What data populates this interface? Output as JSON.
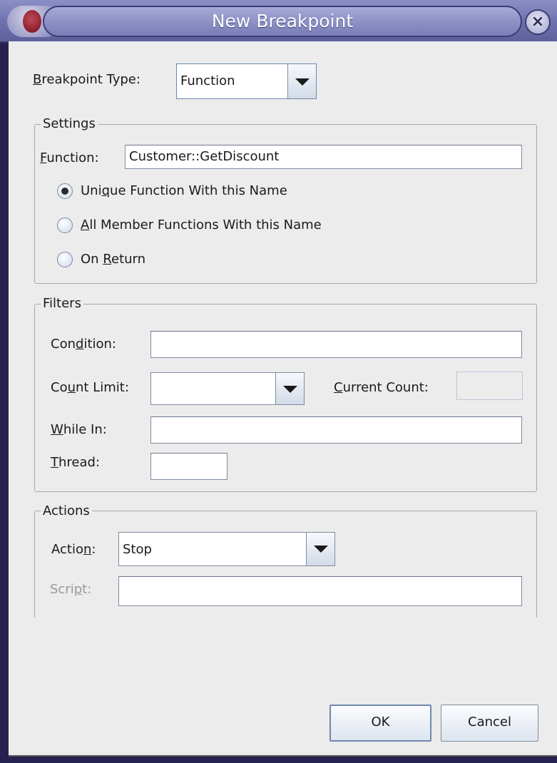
{
  "window": {
    "title": "New Breakpoint",
    "close_symbol": "×"
  },
  "breakpoint_type": {
    "label_mn": "B",
    "label_rest": "reakpoint Type:",
    "value": "Function"
  },
  "settings": {
    "title": "Settings",
    "function_label_mn": "F",
    "function_label_rest": "unction:",
    "function_value": "Customer::GetDiscount",
    "options": [
      {
        "pre": "Uni",
        "mn": "q",
        "post": "ue Function With this Name",
        "checked": true
      },
      {
        "pre": "",
        "mn": "A",
        "post": "ll Member Functions With this Name",
        "checked": false
      },
      {
        "pre": "On ",
        "mn": "R",
        "post": "eturn",
        "checked": false
      }
    ]
  },
  "filters": {
    "title": "Filters",
    "condition_pre": "Con",
    "condition_mn": "d",
    "condition_post": "ition:",
    "condition_value": "",
    "count_limit_pre": "Co",
    "count_limit_mn": "u",
    "count_limit_post": "nt Limit:",
    "count_limit_value": "",
    "current_count_mn": "C",
    "current_count_rest": "urrent Count:",
    "current_count_value": "",
    "while_in_mn": "W",
    "while_in_rest": "hile In:",
    "while_in_value": "",
    "thread_mn": "T",
    "thread_rest": "hread:",
    "thread_value": ""
  },
  "actions": {
    "title": "Actions",
    "action_pre": "Actio",
    "action_mn": "n",
    "action_post": ":",
    "action_value": "Stop",
    "script_pre": "Scri",
    "script_mn": "p",
    "script_post": "t:",
    "script_value": ""
  },
  "buttons": {
    "ok": "OK",
    "cancel": "Cancel"
  }
}
